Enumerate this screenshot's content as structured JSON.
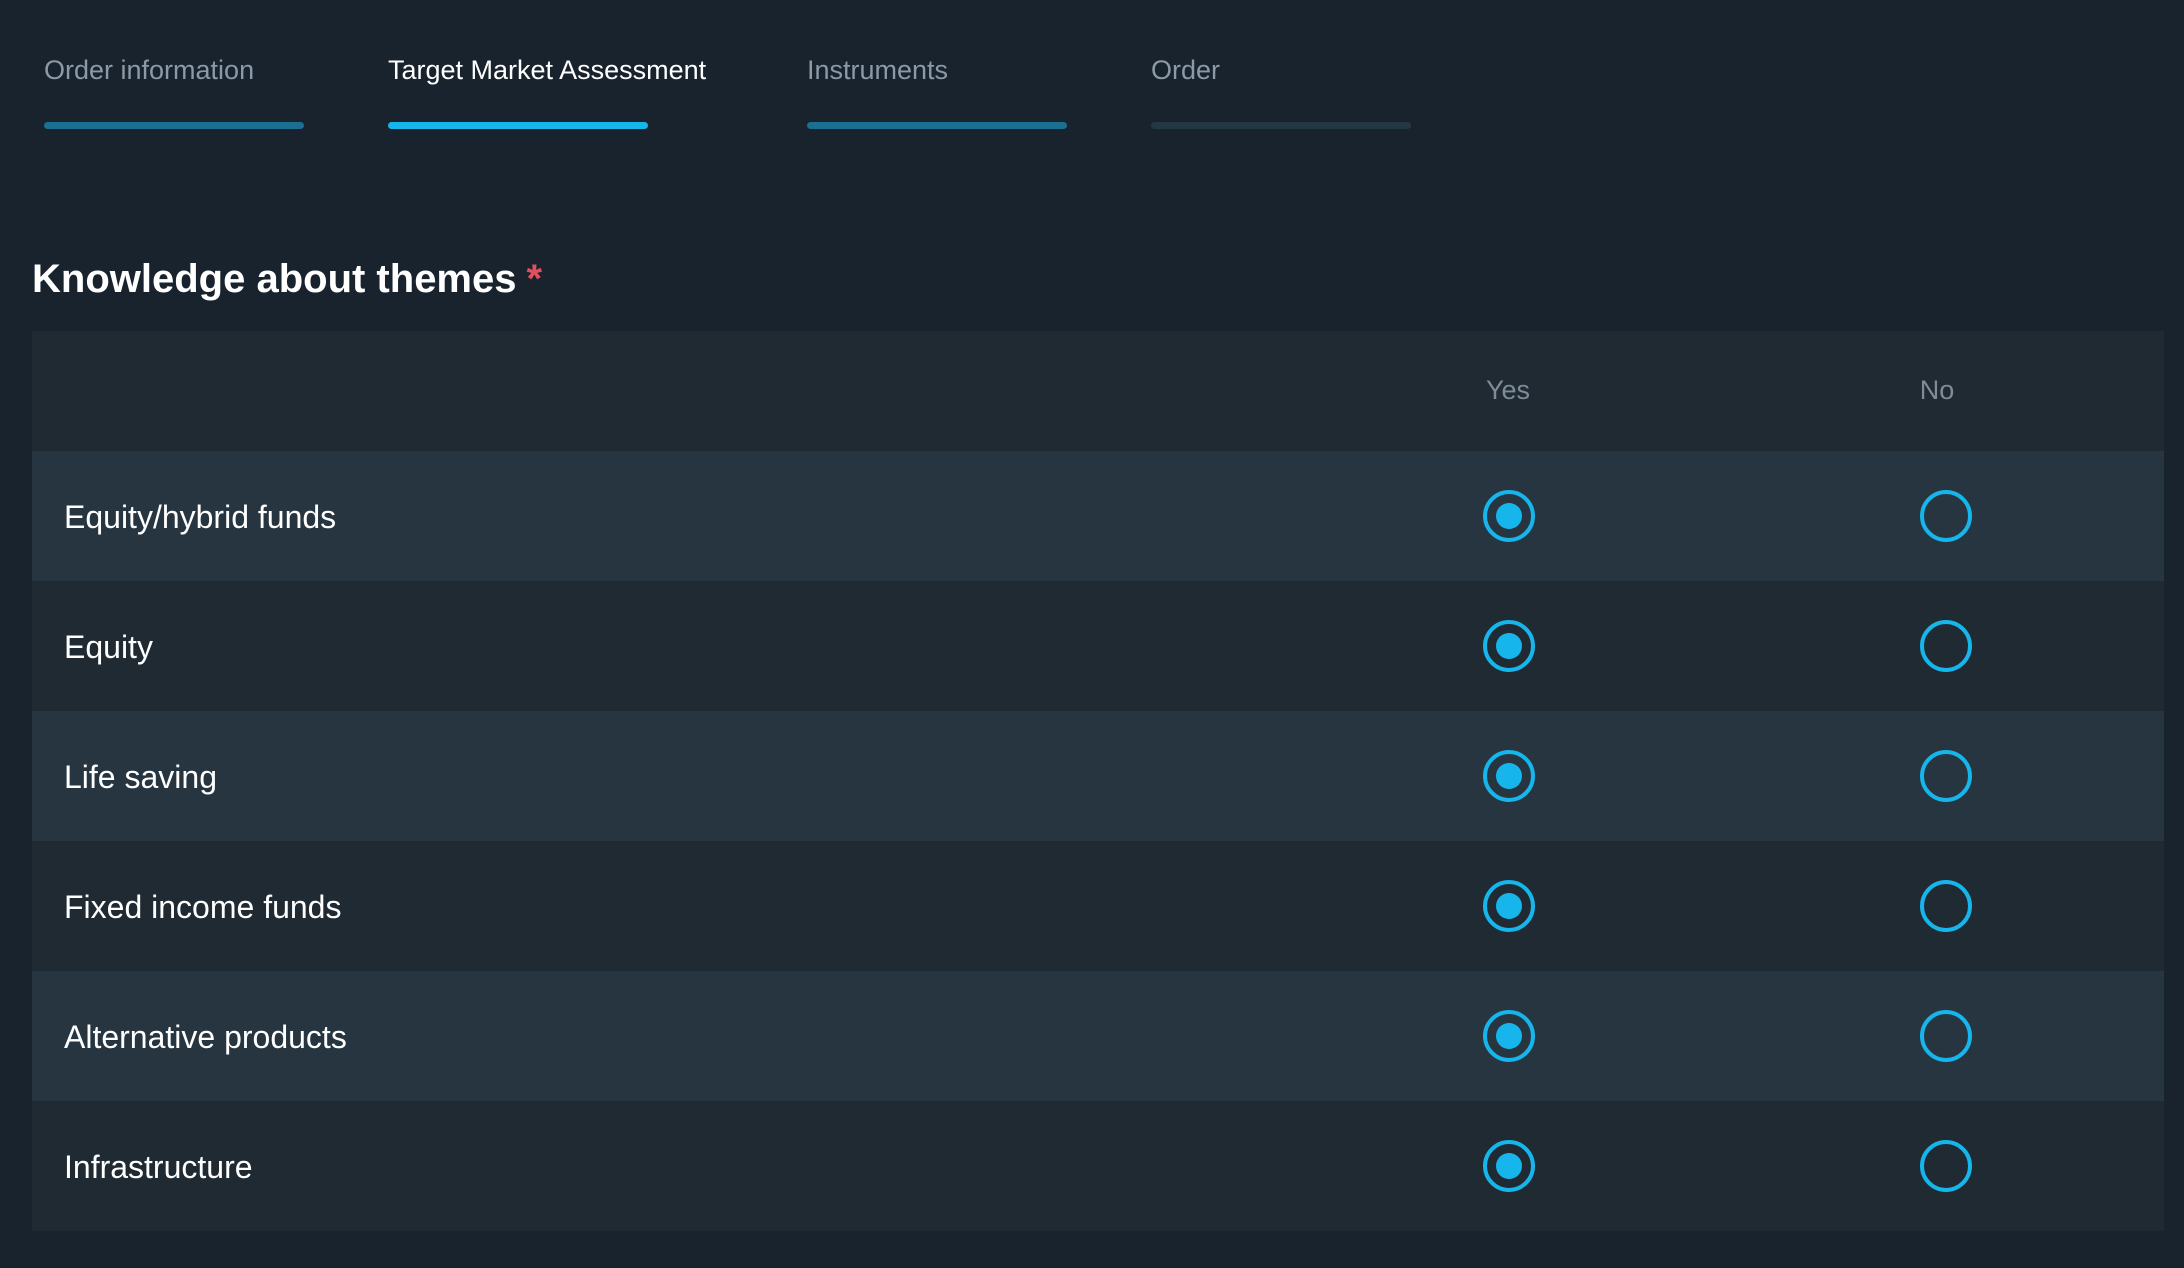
{
  "stepper": {
    "steps": [
      {
        "label": "Order information",
        "state": "completed"
      },
      {
        "label": "Target Market Assessment",
        "state": "active"
      },
      {
        "label": "Instruments",
        "state": "completed"
      },
      {
        "label": "Order",
        "state": "pending"
      }
    ]
  },
  "section": {
    "title": "Knowledge about themes",
    "required_mark": "*"
  },
  "grid": {
    "columns": [
      "Yes",
      "No"
    ],
    "rows": [
      {
        "label": "Equity/hybrid funds",
        "selected": "Yes"
      },
      {
        "label": "Equity",
        "selected": "Yes"
      },
      {
        "label": "Life saving",
        "selected": "Yes"
      },
      {
        "label": "Fixed income funds",
        "selected": "Yes"
      },
      {
        "label": "Alternative products",
        "selected": "Yes"
      },
      {
        "label": "Infrastructure",
        "selected": "Yes"
      }
    ]
  },
  "colors": {
    "page_background": "#19232d",
    "grid_background": "#1f2a33",
    "row_odd": "#263540",
    "row_even": "#1f2a33",
    "accent": "#16b6ec",
    "step_active_bar": "#16b6ec",
    "step_completed_bar": "#1b6f92",
    "step_pending_bar": "#233845",
    "step_active_text": "#ffffff",
    "step_inactive_text": "#8a9aa6",
    "column_header_text": "#7f8c97",
    "required": "#e0505e"
  },
  "icons": {
    "radio_selected": "radio-selected-icon",
    "radio_unselected": "radio-unselected-icon"
  }
}
